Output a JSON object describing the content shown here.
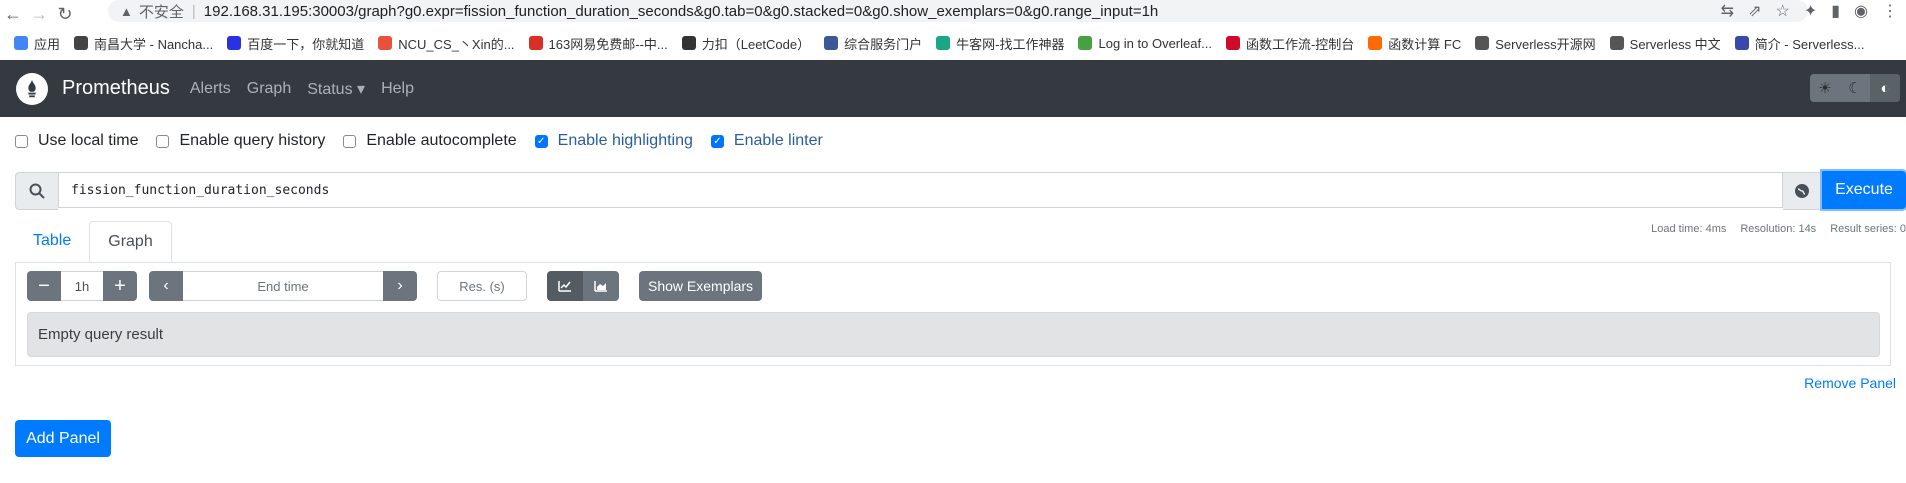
{
  "browser": {
    "insecure_label": "不安全",
    "url": "192.168.31.195:30003/graph?g0.expr=fission_function_duration_seconds&g0.tab=0&g0.stacked=0&g0.show_exemplars=0&g0.range_input=1h"
  },
  "bookmarks": [
    {
      "label": "应用",
      "color": "#4285f4"
    },
    {
      "label": "南昌大学 - Nancha...",
      "color": "#444444"
    },
    {
      "label": "百度一下，你就知道",
      "color": "#2932e1"
    },
    {
      "label": "NCU_CS_丶Xin的...",
      "color": "#e8513a"
    },
    {
      "label": "163网易免费邮--中...",
      "color": "#d93025"
    },
    {
      "label": "力扣（LeetCode）",
      "color": "#333333"
    },
    {
      "label": "综合服务门户",
      "color": "#3b5998"
    },
    {
      "label": "牛客网-找工作神器",
      "color": "#1ba784"
    },
    {
      "label": "Log in to Overleaf...",
      "color": "#47a141"
    },
    {
      "label": "函数工作流-控制台",
      "color": "#cf0a2c"
    },
    {
      "label": "函数计算 FC",
      "color": "#ff6a00"
    },
    {
      "label": "Serverless开源网",
      "color": "#555555"
    },
    {
      "label": "Serverless 中文",
      "color": "#555555"
    },
    {
      "label": "简介 - Serverless...",
      "color": "#3949ab"
    }
  ],
  "navbar": {
    "brand": "Prometheus",
    "links": [
      "Alerts",
      "Graph",
      "Status ▾",
      "Help"
    ]
  },
  "options": {
    "local_time": "Use local time",
    "query_history": "Enable query history",
    "autocomplete": "Enable autocomplete",
    "highlighting": "Enable highlighting",
    "linter": "Enable linter"
  },
  "query": {
    "expression": "fission_function_duration_seconds",
    "execute_label": "Execute"
  },
  "tabs": {
    "table": "Table",
    "graph": "Graph"
  },
  "stats": {
    "load_time": "Load time: 4ms",
    "resolution": "Resolution: 14s",
    "result_series": "Result series: 0"
  },
  "controls": {
    "range": "1h",
    "end_time_placeholder": "End time",
    "res_placeholder": "Res. (s)",
    "show_exemplars": "Show Exemplars"
  },
  "result_message": "Empty query result",
  "remove_panel": "Remove Panel",
  "add_panel": "Add Panel"
}
